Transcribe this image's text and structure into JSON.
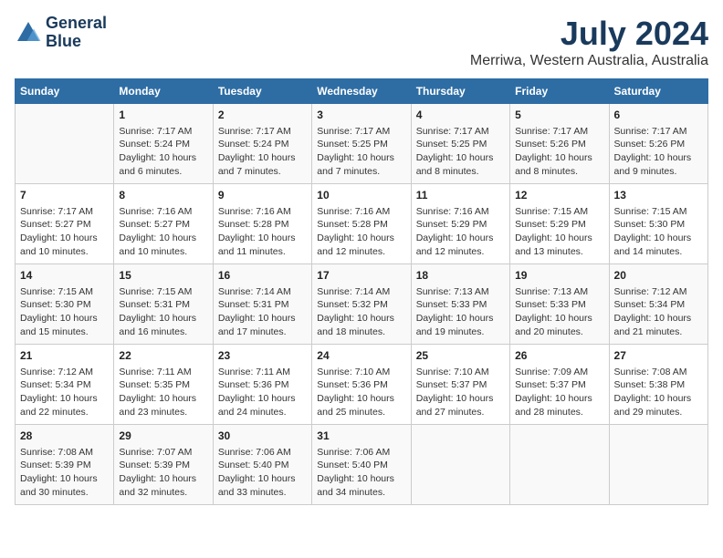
{
  "header": {
    "logo_line1": "General",
    "logo_line2": "Blue",
    "title": "July 2024",
    "subtitle": "Merriwa, Western Australia, Australia"
  },
  "days_of_week": [
    "Sunday",
    "Monday",
    "Tuesday",
    "Wednesday",
    "Thursday",
    "Friday",
    "Saturday"
  ],
  "weeks": [
    [
      {
        "day": "",
        "info": ""
      },
      {
        "day": "1",
        "info": "Sunrise: 7:17 AM\nSunset: 5:24 PM\nDaylight: 10 hours\nand 6 minutes."
      },
      {
        "day": "2",
        "info": "Sunrise: 7:17 AM\nSunset: 5:24 PM\nDaylight: 10 hours\nand 7 minutes."
      },
      {
        "day": "3",
        "info": "Sunrise: 7:17 AM\nSunset: 5:25 PM\nDaylight: 10 hours\nand 7 minutes."
      },
      {
        "day": "4",
        "info": "Sunrise: 7:17 AM\nSunset: 5:25 PM\nDaylight: 10 hours\nand 8 minutes."
      },
      {
        "day": "5",
        "info": "Sunrise: 7:17 AM\nSunset: 5:26 PM\nDaylight: 10 hours\nand 8 minutes."
      },
      {
        "day": "6",
        "info": "Sunrise: 7:17 AM\nSunset: 5:26 PM\nDaylight: 10 hours\nand 9 minutes."
      }
    ],
    [
      {
        "day": "7",
        "info": "Sunrise: 7:17 AM\nSunset: 5:27 PM\nDaylight: 10 hours\nand 10 minutes."
      },
      {
        "day": "8",
        "info": "Sunrise: 7:16 AM\nSunset: 5:27 PM\nDaylight: 10 hours\nand 10 minutes."
      },
      {
        "day": "9",
        "info": "Sunrise: 7:16 AM\nSunset: 5:28 PM\nDaylight: 10 hours\nand 11 minutes."
      },
      {
        "day": "10",
        "info": "Sunrise: 7:16 AM\nSunset: 5:28 PM\nDaylight: 10 hours\nand 12 minutes."
      },
      {
        "day": "11",
        "info": "Sunrise: 7:16 AM\nSunset: 5:29 PM\nDaylight: 10 hours\nand 12 minutes."
      },
      {
        "day": "12",
        "info": "Sunrise: 7:15 AM\nSunset: 5:29 PM\nDaylight: 10 hours\nand 13 minutes."
      },
      {
        "day": "13",
        "info": "Sunrise: 7:15 AM\nSunset: 5:30 PM\nDaylight: 10 hours\nand 14 minutes."
      }
    ],
    [
      {
        "day": "14",
        "info": "Sunrise: 7:15 AM\nSunset: 5:30 PM\nDaylight: 10 hours\nand 15 minutes."
      },
      {
        "day": "15",
        "info": "Sunrise: 7:15 AM\nSunset: 5:31 PM\nDaylight: 10 hours\nand 16 minutes."
      },
      {
        "day": "16",
        "info": "Sunrise: 7:14 AM\nSunset: 5:31 PM\nDaylight: 10 hours\nand 17 minutes."
      },
      {
        "day": "17",
        "info": "Sunrise: 7:14 AM\nSunset: 5:32 PM\nDaylight: 10 hours\nand 18 minutes."
      },
      {
        "day": "18",
        "info": "Sunrise: 7:13 AM\nSunset: 5:33 PM\nDaylight: 10 hours\nand 19 minutes."
      },
      {
        "day": "19",
        "info": "Sunrise: 7:13 AM\nSunset: 5:33 PM\nDaylight: 10 hours\nand 20 minutes."
      },
      {
        "day": "20",
        "info": "Sunrise: 7:12 AM\nSunset: 5:34 PM\nDaylight: 10 hours\nand 21 minutes."
      }
    ],
    [
      {
        "day": "21",
        "info": "Sunrise: 7:12 AM\nSunset: 5:34 PM\nDaylight: 10 hours\nand 22 minutes."
      },
      {
        "day": "22",
        "info": "Sunrise: 7:11 AM\nSunset: 5:35 PM\nDaylight: 10 hours\nand 23 minutes."
      },
      {
        "day": "23",
        "info": "Sunrise: 7:11 AM\nSunset: 5:36 PM\nDaylight: 10 hours\nand 24 minutes."
      },
      {
        "day": "24",
        "info": "Sunrise: 7:10 AM\nSunset: 5:36 PM\nDaylight: 10 hours\nand 25 minutes."
      },
      {
        "day": "25",
        "info": "Sunrise: 7:10 AM\nSunset: 5:37 PM\nDaylight: 10 hours\nand 27 minutes."
      },
      {
        "day": "26",
        "info": "Sunrise: 7:09 AM\nSunset: 5:37 PM\nDaylight: 10 hours\nand 28 minutes."
      },
      {
        "day": "27",
        "info": "Sunrise: 7:08 AM\nSunset: 5:38 PM\nDaylight: 10 hours\nand 29 minutes."
      }
    ],
    [
      {
        "day": "28",
        "info": "Sunrise: 7:08 AM\nSunset: 5:39 PM\nDaylight: 10 hours\nand 30 minutes."
      },
      {
        "day": "29",
        "info": "Sunrise: 7:07 AM\nSunset: 5:39 PM\nDaylight: 10 hours\nand 32 minutes."
      },
      {
        "day": "30",
        "info": "Sunrise: 7:06 AM\nSunset: 5:40 PM\nDaylight: 10 hours\nand 33 minutes."
      },
      {
        "day": "31",
        "info": "Sunrise: 7:06 AM\nSunset: 5:40 PM\nDaylight: 10 hours\nand 34 minutes."
      },
      {
        "day": "",
        "info": ""
      },
      {
        "day": "",
        "info": ""
      },
      {
        "day": "",
        "info": ""
      }
    ]
  ]
}
